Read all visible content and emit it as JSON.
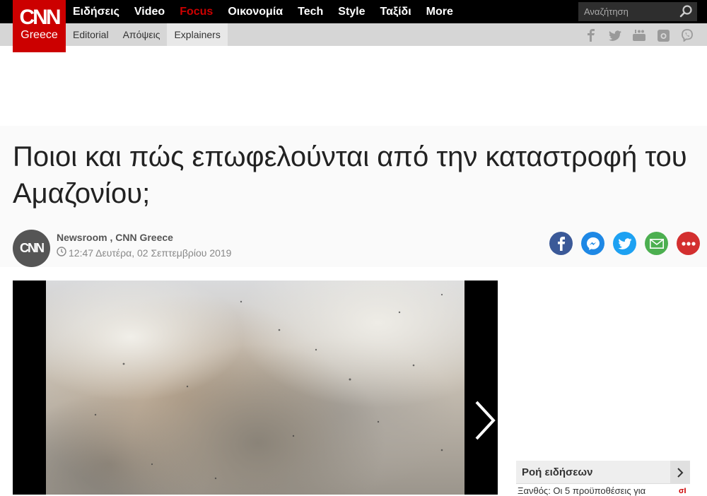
{
  "logo": {
    "brand": "CNN",
    "sub": "Greece"
  },
  "nav": {
    "items": [
      {
        "label": "Ειδήσεις",
        "active": false
      },
      {
        "label": "Video",
        "active": false
      },
      {
        "label": "Focus",
        "active": true
      },
      {
        "label": "Οικονομία",
        "active": false
      },
      {
        "label": "Tech",
        "active": false
      },
      {
        "label": "Style",
        "active": false
      },
      {
        "label": "Ταξίδι",
        "active": false
      },
      {
        "label": "More",
        "active": false
      }
    ]
  },
  "search": {
    "placeholder": "Αναζήτηση"
  },
  "subnav": {
    "items": [
      {
        "label": "Editorial"
      },
      {
        "label": "Απόψεις"
      },
      {
        "label": "Explainers"
      }
    ]
  },
  "article": {
    "title": "Ποιοι και πώς επωφελούνται από την καταστροφή του Αμαζονίου;",
    "author": "Newsroom , CNN Greece",
    "date": "12:47 Δευτέρα, 02 Σεπτεμβρίου 2019",
    "avatar_text": "CNN"
  },
  "share": [
    {
      "name": "facebook",
      "color": "#3b5998"
    },
    {
      "name": "messenger",
      "color": "#1e88e5"
    },
    {
      "name": "twitter",
      "color": "#1da1f2"
    },
    {
      "name": "email",
      "color": "#4caf50"
    },
    {
      "name": "more",
      "color": "#d32f2f"
    }
  ],
  "feed": {
    "title": "Ροή ειδήσεων",
    "first_item": "Ξανθός: Οι 5 προϋποθέσεις για",
    "first_item_badge": "σΙ"
  },
  "colors": {
    "brand_red": "#cc0000",
    "topbar": "#000000",
    "subbar": "#d6d6d6"
  }
}
